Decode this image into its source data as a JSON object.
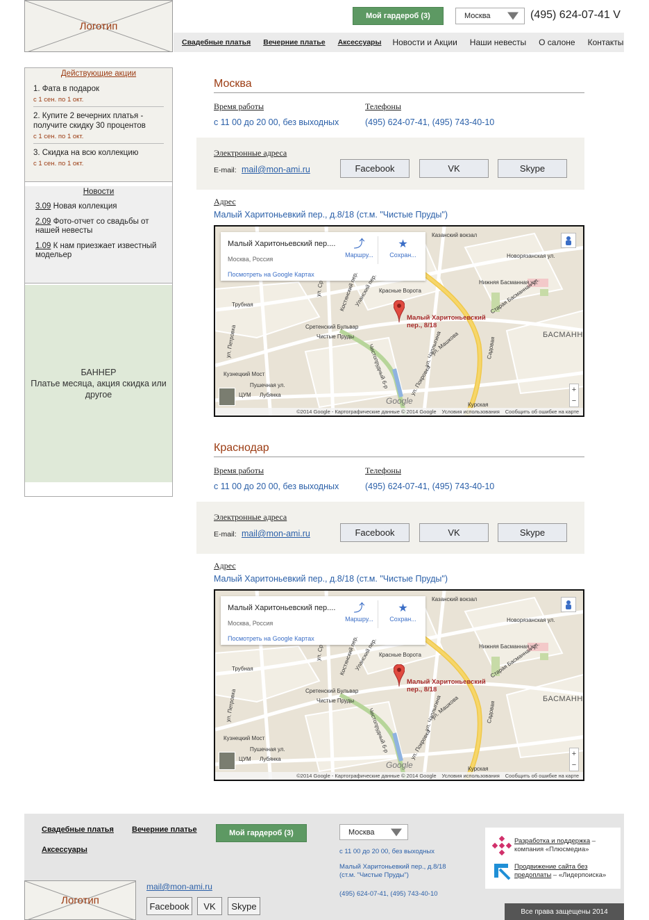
{
  "header": {
    "logo_text": "Логотип",
    "wardrobe_label": "Мой гардероб (3)",
    "city": "Москва",
    "phone": "(495) 624-07-41 V"
  },
  "nav": {
    "items": [
      {
        "label": "Свадебные платья"
      },
      {
        "label": "Вечерние платье"
      },
      {
        "label": "Аксессуары"
      },
      {
        "label": "Новости и Акции"
      },
      {
        "label": "Наши невесты"
      },
      {
        "label": "О салоне"
      },
      {
        "label": "Контакты"
      }
    ]
  },
  "sidebar": {
    "promo_title": "Действующие акции",
    "promos": [
      {
        "title": "1. Фата в подарок",
        "dates": "с 1 сен. по 1 окт."
      },
      {
        "title": "2. Купите 2 вечерних платья - получите скидку 30 процентов",
        "dates": "с 1 сен. по 1 окт."
      },
      {
        "title": "3. Скидка на всю коллекцию",
        "dates": "с 1 сен. по 1 окт."
      }
    ],
    "news_title": "Новости",
    "news": [
      {
        "date": "3.09",
        "text": " Новая коллекция"
      },
      {
        "date": "2.09",
        "text": " Фото-отчет со свадьбы от нашей невесты"
      },
      {
        "date": "1.09",
        "text": " К нам приезжает известный модельер"
      }
    ],
    "banner_title": "БАННЕР",
    "banner_text": "Платье месяца, акция скидка или другое"
  },
  "cities": [
    {
      "name": "Москва",
      "hours_label": "Время работы",
      "hours": "с 11 00 до 20 00, без выходных",
      "phones_label": "Телефоны",
      "phones": "(495) 624-07-41, (495) 743-40-10",
      "emails_label": "Электронные адреса",
      "email_label": "E-mail:",
      "email": "mail@mon-ami.ru",
      "socials": [
        "Facebook",
        "VK",
        "Skype"
      ],
      "address_label": "Адрес",
      "address": "Малый Харитоньевкий пер., д.8/18 (ст.м. \"Чистые Пруды\")"
    },
    {
      "name": "Краснодар",
      "hours_label": "Время работы",
      "hours": "с 11 00 до 20 00, без выходных",
      "phones_label": "Телефоны",
      "phones": "(495) 624-07-41, (495) 743-40-10",
      "emails_label": "Электронные адреса",
      "email_label": "E-mail:",
      "email": "mail@mon-ami.ru",
      "socials": [
        "Facebook",
        "VK",
        "Skype"
      ],
      "address_label": "Адрес",
      "address": "Малый Харитоньевкий пер., д.8/18 (ст.м. \"Чистые Пруды\")"
    }
  ],
  "map": {
    "place_name": "Малый Харитоньевский пер....",
    "place_sub": "Москва, Россия",
    "google_link": "Посмотреть на Google Картах",
    "route_label": "Маршру...",
    "save_label": "Сохран...",
    "pin_label_1": "Малый Харитоньевский",
    "pin_label_2": "пер., 8/18",
    "google_logo": "Google",
    "attr_1": "©2014 Google - Картографические данные © 2014 Google",
    "attr_2": "Условия использования",
    "attr_3": "Сообщить об ошибке на карте",
    "zoom_in": "+",
    "zoom_out": "−",
    "streets": {
      "kazansky": "Казанский вокзал",
      "trubnaya": "Трубная",
      "krasnye_vorota": "Красные Ворота",
      "sretensky": "Сретенский Бульвар",
      "chistye": "Чистые Пруды",
      "kuznetsky": "Кузнецкий Мост",
      "tsum": "ЦУМ",
      "lubyanka": "Лубянка",
      "kurskaya": "Курская",
      "basmanny": "БАСМАННЫ",
      "novoryazanskaya": "Новорязанская ул.",
      "nizhnyaya_basmannaya": "Нижняя Басманная ул.",
      "staraya_basmannaya": "Старая Басманная ул.",
      "mashkova": "ул. Машкова",
      "pushechnaya": "Пушечная ул.",
      "chistoprudny": "Чистопрудный б-р",
      "pokrovka": "ул. Покровка",
      "petrovka": "ул. Петровка",
      "chaplygina": "ул. Чаплыгина",
      "sadovaya": "Садовая",
      "kostyansky": "Костянский пер.",
      "ulansky": "Уланский пер.",
      "sr": "ул. Ср"
    }
  },
  "footer": {
    "links": [
      "Свадебные платья",
      "Вечерние платье",
      "Аксессуары"
    ],
    "wardrobe_label": "Мой гардероб (3)",
    "city": "Москва",
    "hours": "с 11 00 до 20 00, без выходных",
    "address_1": "Малый Харитоньевкий пер., д.8/18",
    "address_2": "(ст.м. \"Чистые Пруды\")",
    "phones": "(495) 624-07-41, (495) 743-40-10",
    "logo_text": "Логотип",
    "email": "mail@mon-ami.ru",
    "socials": [
      "Facebook",
      "VK",
      "Skype"
    ],
    "dev_link": "Разработка и поддержка",
    "dev_rest": " – компания «Плюсмедиа»",
    "promo_link": "Продвижение сайта без предоплаты",
    "promo_rest": " – «Лидерпоиска»",
    "copyright": "Все права защещены 2014"
  },
  "colors": {
    "accent": "#9b3b12",
    "link": "#2a5fa8",
    "button_green": "#5d9963"
  }
}
